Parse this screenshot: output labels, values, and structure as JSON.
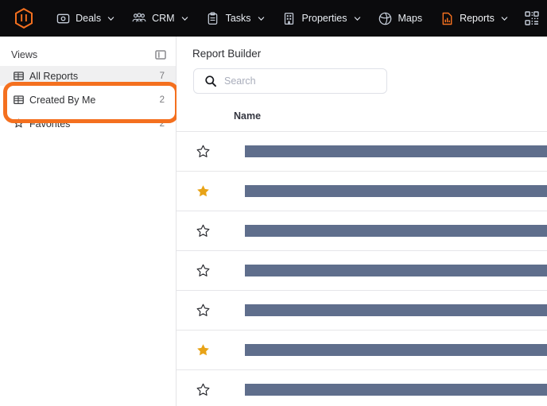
{
  "topnav": {
    "logo_name": "company-logo",
    "logo_color": "#f4701f",
    "items": [
      {
        "label": "Deals",
        "icon": "wallet-icon",
        "has_dropdown": true,
        "active": false
      },
      {
        "label": "CRM",
        "icon": "people-icon",
        "has_dropdown": true,
        "active": false
      },
      {
        "label": "Tasks",
        "icon": "clipboard-icon",
        "has_dropdown": true,
        "active": false
      },
      {
        "label": "Properties",
        "icon": "building-icon",
        "has_dropdown": true,
        "active": false
      },
      {
        "label": "Maps",
        "icon": "globe-icon",
        "has_dropdown": false,
        "active": false
      },
      {
        "label": "Reports",
        "icon": "report-chart-icon",
        "has_dropdown": true,
        "active": true
      }
    ],
    "right_icon": "qr-code-icon"
  },
  "sidebar": {
    "title": "Views",
    "collapse_icon": "panel-toggle-icon",
    "items": [
      {
        "label": "All Reports",
        "count": "7",
        "icon": "table-icon",
        "selected": true
      },
      {
        "label": "Created By Me",
        "count": "2",
        "icon": "table-icon",
        "selected": false
      },
      {
        "label": "Favorites",
        "count": "2",
        "icon": "star-outline-icon",
        "selected": false
      }
    ]
  },
  "annotation": {
    "name": "highlight-box",
    "color": "#f4701f",
    "surrounds": [
      "Created By Me",
      "Favorites"
    ]
  },
  "main": {
    "page_title": "Report Builder",
    "search": {
      "value": "",
      "placeholder": "Search",
      "icon": "search-icon"
    },
    "table": {
      "columns": [
        "",
        "Name"
      ],
      "rows": [
        {
          "favorite": false,
          "name": ""
        },
        {
          "favorite": true,
          "name": ""
        },
        {
          "favorite": false,
          "name": ""
        },
        {
          "favorite": false,
          "name": ""
        },
        {
          "favorite": false,
          "name": ""
        },
        {
          "favorite": true,
          "name": ""
        },
        {
          "favorite": false,
          "name": ""
        }
      ]
    }
  },
  "colors": {
    "nav_background": "#0b0b0d",
    "accent_orange": "#f4701f",
    "star_filled": "#e8a317",
    "redaction_bar": "#5f6e8c",
    "selected_row": "#f0f0f1"
  }
}
